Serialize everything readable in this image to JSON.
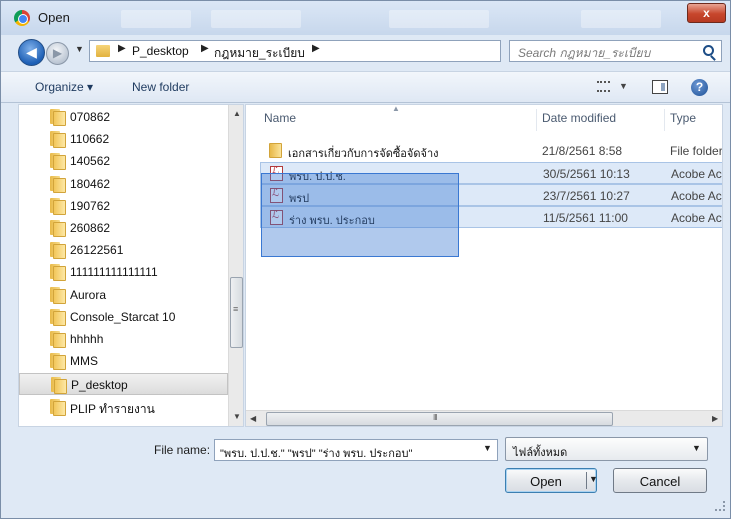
{
  "window": {
    "title": "Open",
    "close_label": "x"
  },
  "address": {
    "breadcrumbs": [
      "P_desktop",
      "กฎหมาย_ระเบียบ"
    ],
    "search_placeholder": "Search กฎหมาย_ระเบียบ"
  },
  "toolbar": {
    "organize_label": "Organize ▾",
    "new_folder_label": "New folder"
  },
  "sidebar": {
    "items": [
      {
        "label": "070862",
        "selected": false
      },
      {
        "label": "110662",
        "selected": false
      },
      {
        "label": "140562",
        "selected": false
      },
      {
        "label": "180462",
        "selected": false
      },
      {
        "label": "190762",
        "selected": false
      },
      {
        "label": "260862",
        "selected": false
      },
      {
        "label": "26122561",
        "selected": false
      },
      {
        "label": "111111111111111",
        "selected": false
      },
      {
        "label": "Aurora",
        "selected": false
      },
      {
        "label": "Console_Starcat 10",
        "selected": false
      },
      {
        "label": "hhhhh",
        "selected": false
      },
      {
        "label": "MMS",
        "selected": false
      },
      {
        "label": "P_desktop",
        "selected": true
      },
      {
        "label": "PLIP ทำรายงาน",
        "selected": false
      }
    ]
  },
  "file_list": {
    "columns": {
      "name": "Name",
      "date": "Date modified",
      "type": "Type"
    },
    "rows": [
      {
        "icon": "folder-icon",
        "name": "เอกสารเกี่ยวกับการจัดซื้อจัดจ้าง",
        "date": "21/8/2561 8:58",
        "type": "File folder",
        "selected": false
      },
      {
        "icon": "pdf-icon",
        "name": "พรบ. ป.ป.ช.",
        "date": "30/5/2561 10:13",
        "type": "Acobe Ac",
        "selected": true
      },
      {
        "icon": "pdf-icon",
        "name": "พรป",
        "date": "23/7/2561 10:27",
        "type": "Acobe Ac",
        "selected": true
      },
      {
        "icon": "pdf-icon",
        "name": "ร่าง พรบ. ประกอบ",
        "date": "11/5/2561 11:00",
        "type": "Acobe Ac",
        "selected": true
      }
    ]
  },
  "bottom": {
    "file_name_label": "File name:",
    "file_name_value": "\"พรบ. ป.ป.ช.\" \"พรป\" \"ร่าง พรบ. ประกอบ\"",
    "file_type_value": "ไฟล์ทั้งหมด",
    "open_label": "Open",
    "cancel_label": "Cancel"
  }
}
